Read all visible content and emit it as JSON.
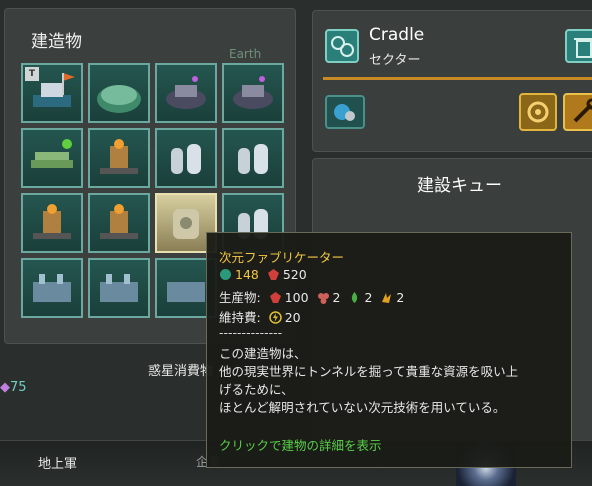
{
  "buildings": {
    "title": "建造物",
    "earth_label": "Earth",
    "corner_badge": "T"
  },
  "sector": {
    "name": "Cradle",
    "subtitle": "セクター"
  },
  "queue": {
    "title": "建設キュー"
  },
  "planet_label": "惑星消費物",
  "resource_75": "75",
  "bottom": {
    "ground_army": "地上軍",
    "enterprise": "企業"
  },
  "tooltip": {
    "title": "次元ファブリケーター",
    "cost_alloys": "148",
    "cost_minerals": "520",
    "production_label": "生産物:",
    "prod_minerals": "100",
    "prod_rare1": "2",
    "prod_rare2": "2",
    "prod_rare3": "2",
    "upkeep_label": "維持費:",
    "upkeep_energy": "20",
    "separator": "--------------",
    "desc_1": "この建造物は、",
    "desc_2": "他の現実世界にトンネルを掘って貴重な資源を吸い上",
    "desc_3": "げるために、",
    "desc_4": "ほとんど解明されていない次元技術を用いている。",
    "link": "クリックで建物の詳細を表示"
  },
  "colors": {
    "accent": "#c88a24",
    "teal": "#2b7f7a",
    "tooltip_title": "#f2c744",
    "link": "#58d04a"
  }
}
